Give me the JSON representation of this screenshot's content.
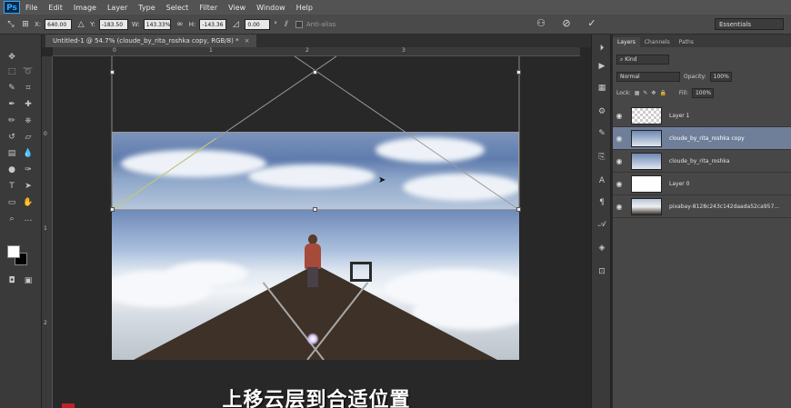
{
  "app": {
    "logo": "Ps"
  },
  "menu": [
    "File",
    "Edit",
    "Image",
    "Layer",
    "Type",
    "Select",
    "Filter",
    "View",
    "Window",
    "Help"
  ],
  "options": {
    "x_label": "X:",
    "x_value": "640.00 px",
    "y_label": "Y:",
    "y_value": "-183.50 p",
    "w_label": "W:",
    "w_value": "143.33%",
    "h_label": "H:",
    "h_value": "-143.36",
    "angle_value": "0.00",
    "angle_unit": "°",
    "antialias_label": "Anti-alias",
    "workspace": "Essentials"
  },
  "document": {
    "tab_title": "Untitled-1 @ 54.7% (cloude_by_rita_roshka copy, RGB/8) *",
    "close": "×"
  },
  "rulers": {
    "top": [
      "0",
      "1",
      "2",
      "3"
    ],
    "left": [
      "0",
      "1",
      "2"
    ]
  },
  "subtitle": "上移云层到合适位置",
  "panel": {
    "tabs": [
      "Layers",
      "Channels",
      "Paths"
    ],
    "filter_kind": "Kind",
    "blend_mode": "Normal",
    "opacity_label": "Opacity:",
    "opacity_value": "100%",
    "lock_label": "Lock:",
    "fill_label": "Fill:",
    "fill_value": "100%",
    "layers": [
      {
        "name": "Layer 1"
      },
      {
        "name": "cloude_by_rita_roshka copy"
      },
      {
        "name": "cloude_by_rita_roshka"
      },
      {
        "name": "Layer 0"
      },
      {
        "name": "pixabay-8128c243c142daada52ca957..."
      }
    ]
  },
  "colors": {
    "accent": "#31a8ff",
    "selection": "#6f7f99",
    "panel_bg": "#474747"
  }
}
